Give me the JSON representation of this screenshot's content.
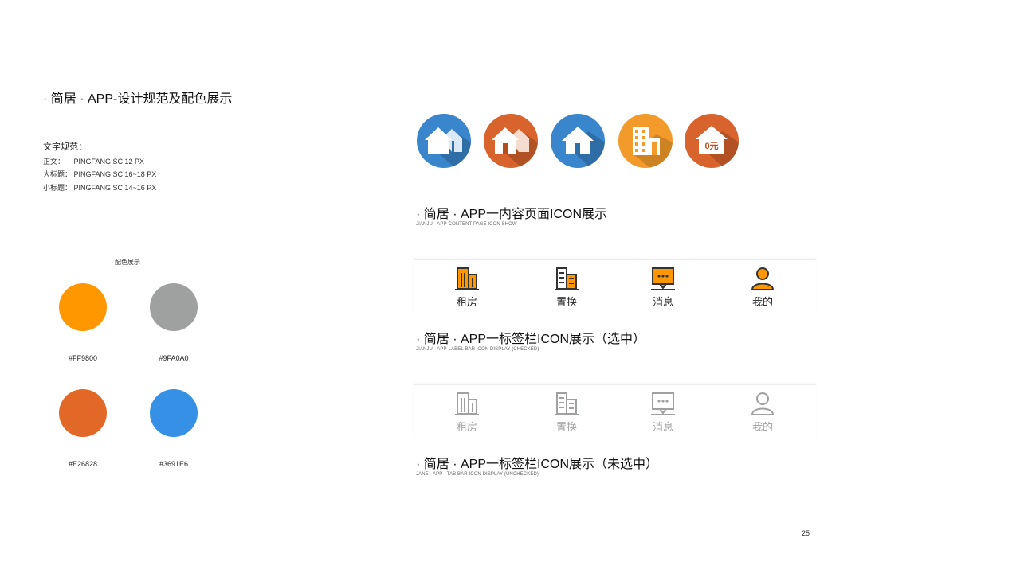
{
  "left": {
    "title": "· 简居 · APP-设计规范及配色展示",
    "text_spec_title": "文字规范：",
    "text_specs": [
      {
        "label": "正文：",
        "value": "PINGFANG SC  12 PX"
      },
      {
        "label": "大标题：",
        "value": "PINGFANG SC  16~18 PX"
      },
      {
        "label": "小标题：",
        "value": "PINGFANG SC  14~16 PX"
      }
    ],
    "palette_title": "配色展示",
    "colors": [
      "#FF9800",
      "#9FA0A0",
      "#E26828",
      "#3691E6"
    ],
    "color_codes": [
      "#FF9800",
      "#9FA0A0",
      "#E26828",
      "#3691E6"
    ]
  },
  "content_icons": {
    "icons": [
      "house-pair-icon",
      "house-pair-icon",
      "house-icon",
      "building-icon",
      "price-house-icon"
    ],
    "colors": [
      "#3A86CC",
      "#D9632C",
      "#3A86CC",
      "#F29A2A",
      "#D9632C"
    ],
    "price_label": "0元",
    "title": "· 简居 · APP一内容页面ICON展示",
    "subtitle": "JIANJU · APP-CONTENT PAGE ICON SHOW"
  },
  "tabbar_checked": {
    "tabs": [
      {
        "label": "租房",
        "icon": "rent-building-icon"
      },
      {
        "label": "置换",
        "icon": "exchange-building-icon"
      },
      {
        "label": "消息",
        "icon": "message-icon"
      },
      {
        "label": "我的",
        "icon": "user-icon"
      }
    ],
    "title": "· 简居 · APP一标签栏ICON展示（选中）",
    "subtitle": "JIANJU · APP-LABEL BAR ICON DISPLAY (CHECKED)"
  },
  "tabbar_unchecked": {
    "tabs": [
      {
        "label": "租房",
        "icon": "rent-building-icon"
      },
      {
        "label": "置换",
        "icon": "exchange-building-icon"
      },
      {
        "label": "消息",
        "icon": "message-icon"
      },
      {
        "label": "我的",
        "icon": "user-icon"
      }
    ],
    "title": "· 简居 · APP一标签栏ICON展示（未选中）",
    "subtitle": "JANE  ·  APP - TAB BAR ICON DISPLAY (UNCHECKED)"
  },
  "page_number": "25"
}
